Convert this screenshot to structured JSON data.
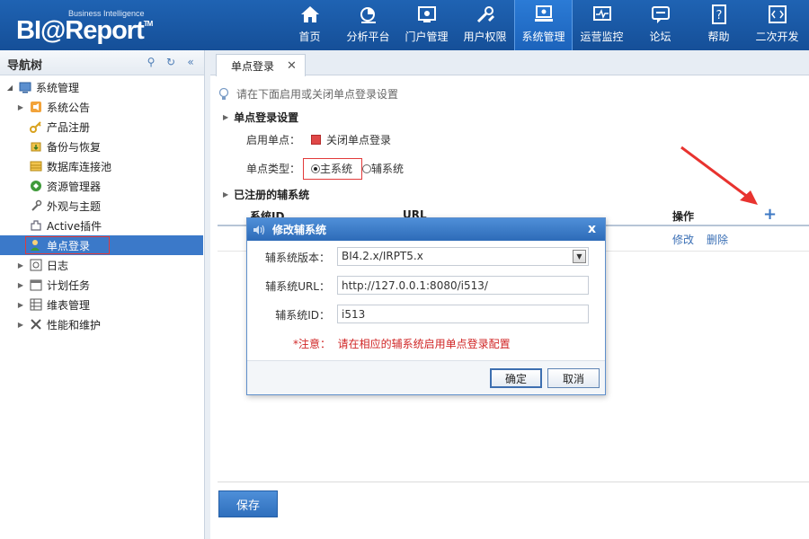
{
  "brand": {
    "sub": "Business Intelligence",
    "main": "BI@Report",
    "tm": "TM"
  },
  "nav": [
    {
      "label": "首页",
      "icon": "home-icon"
    },
    {
      "label": "分析平台",
      "icon": "analysis-icon"
    },
    {
      "label": "门户管理",
      "icon": "portal-icon"
    },
    {
      "label": "用户权限",
      "icon": "tools-icon"
    },
    {
      "label": "系统管理",
      "icon": "monitor-icon",
      "active": true
    },
    {
      "label": "运营监控",
      "icon": "pulse-icon"
    },
    {
      "label": "论坛",
      "icon": "forum-icon"
    },
    {
      "label": "帮助",
      "icon": "help-icon"
    },
    {
      "label": "二次开发",
      "icon": "code-icon"
    }
  ],
  "sidebar": {
    "title": "导航树",
    "items": [
      {
        "label": "系统管理",
        "icon": "system-icon"
      },
      {
        "label": "系统公告",
        "icon": "announcement-icon"
      },
      {
        "label": "产品注册",
        "icon": "key-icon"
      },
      {
        "label": "备份与恢复",
        "icon": "backup-icon"
      },
      {
        "label": "数据库连接池",
        "icon": "database-icon"
      },
      {
        "label": "资源管理器",
        "icon": "resource-icon"
      },
      {
        "label": "外观与主题",
        "icon": "theme-icon"
      },
      {
        "label": "Active插件",
        "icon": "plugin-icon"
      },
      {
        "label": "单点登录",
        "icon": "sso-icon"
      },
      {
        "label": "日志",
        "icon": "log-icon"
      },
      {
        "label": "计划任务",
        "icon": "calendar-icon"
      },
      {
        "label": "维表管理",
        "icon": "table-icon"
      },
      {
        "label": "性能和维护",
        "icon": "maintenance-icon"
      }
    ]
  },
  "tab": {
    "label": "单点登录",
    "close": "✕"
  },
  "hint": "请在下面启用或关闭单点登录设置",
  "settings": {
    "section_title": "单点登录设置",
    "enable_label": "启用单点：",
    "enable_value": "关闭单点登录",
    "type_label": "单点类型：",
    "type_options": [
      "主系统",
      "辅系统"
    ]
  },
  "registered": {
    "section_title": "已注册的辅系统",
    "columns": [
      "系统ID",
      "URL",
      "操作"
    ],
    "row_actions": [
      "修改",
      "删除"
    ],
    "add_label": "+"
  },
  "save_label": "保存",
  "dialog": {
    "title": "修改辅系统",
    "close": "x",
    "version_label": "辅系统版本：",
    "version_value": "BI4.2.x/IRPT5.x",
    "url_label": "辅系统URL：",
    "url_value": "http://127.0.0.1:8080/i513/",
    "id_label": "辅系统ID：",
    "id_value": "i513",
    "note_prefix": "*注意：",
    "note_text": "请在相应的辅系统启用单点登录配置",
    "ok_label": "确定",
    "cancel_label": "取消"
  }
}
